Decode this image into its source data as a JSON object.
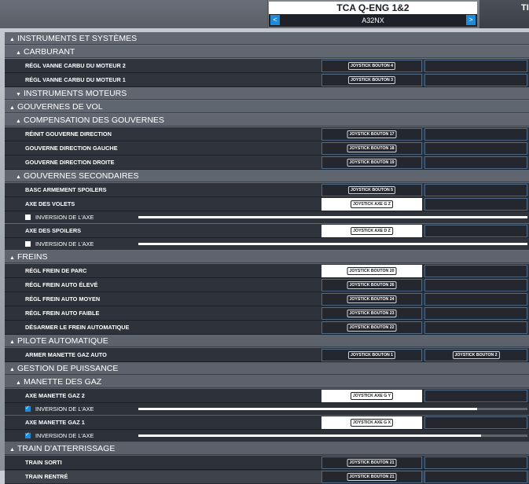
{
  "header": {
    "device_name": "TCA Q-ENG 1&2",
    "profile_name": "A32NX",
    "right_tab_label": "TI"
  },
  "list": [
    {
      "kind": "section",
      "level": 1,
      "expanded": true,
      "label": "INSTRUMENTS ET SYSTÈMES"
    },
    {
      "kind": "section",
      "level": 2,
      "expanded": true,
      "label": "CARBURANT"
    },
    {
      "kind": "item",
      "label": "RÉGL VANNE CARBU DU MOTEUR 2",
      "binding1": "JOYSTICK BOUTON 4",
      "binding2": "",
      "selected": false
    },
    {
      "kind": "item",
      "label": "RÉGL VANNE CARBU DU MOTEUR 1",
      "binding1": "JOYSTICK BOUTON 3",
      "binding2": "",
      "selected": false
    },
    {
      "kind": "section",
      "level": 2,
      "expanded": false,
      "label": "INSTRUMENTS MOTEURS"
    },
    {
      "kind": "section",
      "level": 1,
      "expanded": true,
      "label": "GOUVERNES DE VOL"
    },
    {
      "kind": "section",
      "level": 2,
      "expanded": true,
      "label": "COMPENSATION DES GOUVERNES"
    },
    {
      "kind": "item",
      "label": "RÉINIT GOUVERNE DIRECTION",
      "binding1": "JOYSTICK BOUTON 17",
      "binding2": "",
      "selected": false
    },
    {
      "kind": "item",
      "label": "GOUVERNE DIRECTION GAUCHE",
      "binding1": "JOYSTICK BOUTON 18",
      "binding2": "",
      "selected": false
    },
    {
      "kind": "item",
      "label": "GOUVERNE DIRECTION DROITE",
      "binding1": "JOYSTICK BOUTON 19",
      "binding2": "",
      "selected": false
    },
    {
      "kind": "section",
      "level": 2,
      "expanded": true,
      "label": "GOUVERNES SECONDAIRES"
    },
    {
      "kind": "item",
      "label": "BASC ARMEMENT SPOILERS",
      "binding1": "JOYSTICK BOUTON 5",
      "binding2": "",
      "selected": false
    },
    {
      "kind": "item",
      "label": "AXE DES VOLETS",
      "binding1": "JOYSTICK AXE G Z",
      "binding2": "",
      "selected": true
    },
    {
      "kind": "invert",
      "label": "INVERSION DE L'AXE",
      "checked": false,
      "level": 1.0
    },
    {
      "kind": "item",
      "label": "AXE DES SPOILERS",
      "binding1": "JOYSTICK AXE D Z",
      "binding2": "",
      "selected": true
    },
    {
      "kind": "invert",
      "label": "INVERSION DE L'AXE",
      "checked": false,
      "level": 1.0
    },
    {
      "kind": "section",
      "level": 1,
      "expanded": true,
      "label": "FREINS"
    },
    {
      "kind": "item",
      "label": "RÉGL FREIN DE PARC",
      "binding1": "JOYSTICK BOUTON 20",
      "binding2": "",
      "selected": true
    },
    {
      "kind": "item",
      "label": "RÉGL FREIN AUTO ÉLEVÉ",
      "binding1": "JOYSTICK BOUTON 26",
      "binding2": "",
      "selected": false
    },
    {
      "kind": "item",
      "label": "RÉGL FREIN AUTO MOYEN",
      "binding1": "JOYSTICK BOUTON 24",
      "binding2": "",
      "selected": false
    },
    {
      "kind": "item",
      "label": "RÉGL FREIN AUTO FAIBLE",
      "binding1": "JOYSTICK BOUTON 23",
      "binding2": "",
      "selected": false
    },
    {
      "kind": "item",
      "label": "DÉSARMER LE FREIN AUTOMATIQUE",
      "binding1": "JOYSTICK BOUTON 22",
      "binding2": "",
      "selected": false
    },
    {
      "kind": "section",
      "level": 1,
      "expanded": true,
      "label": "PILOTE AUTOMATIQUE"
    },
    {
      "kind": "item",
      "label": "ARMER MANETTE GAZ AUTO",
      "binding1": "JOYSTICK BOUTON 1",
      "binding2": "JOYSTICK BOUTON 2",
      "selected": false
    },
    {
      "kind": "section",
      "level": 1,
      "expanded": true,
      "label": "GESTION DE PUISSANCE"
    },
    {
      "kind": "section",
      "level": 2,
      "expanded": true,
      "label": "MANETTE DES GAZ"
    },
    {
      "kind": "item",
      "label": "AXE MANETTE GAZ 2",
      "binding1": "JOYSTICK AXE G Y",
      "binding2": "",
      "selected": true
    },
    {
      "kind": "invert",
      "label": "INVERSION DE L'AXE",
      "checked": true,
      "level": 0.87
    },
    {
      "kind": "item",
      "label": "AXE MANETTE GAZ 1",
      "binding1": "JOYSTICK AXE G X",
      "binding2": "",
      "selected": true
    },
    {
      "kind": "invert",
      "label": "INVERSION DE L'AXE",
      "checked": true,
      "level": 0.88
    },
    {
      "kind": "section",
      "level": 1,
      "expanded": true,
      "label": "TRAIN D'ATTERRISSAGE"
    },
    {
      "kind": "item",
      "label": "TRAIN SORTI",
      "binding1": "JOYSTICK BOUTON 21",
      "binding2": "",
      "selected": false
    },
    {
      "kind": "item",
      "label": "TRAIN RENTRÉ",
      "binding1": "JOYSTICK BOUTON 21",
      "binding2": "",
      "selected": false
    }
  ]
}
